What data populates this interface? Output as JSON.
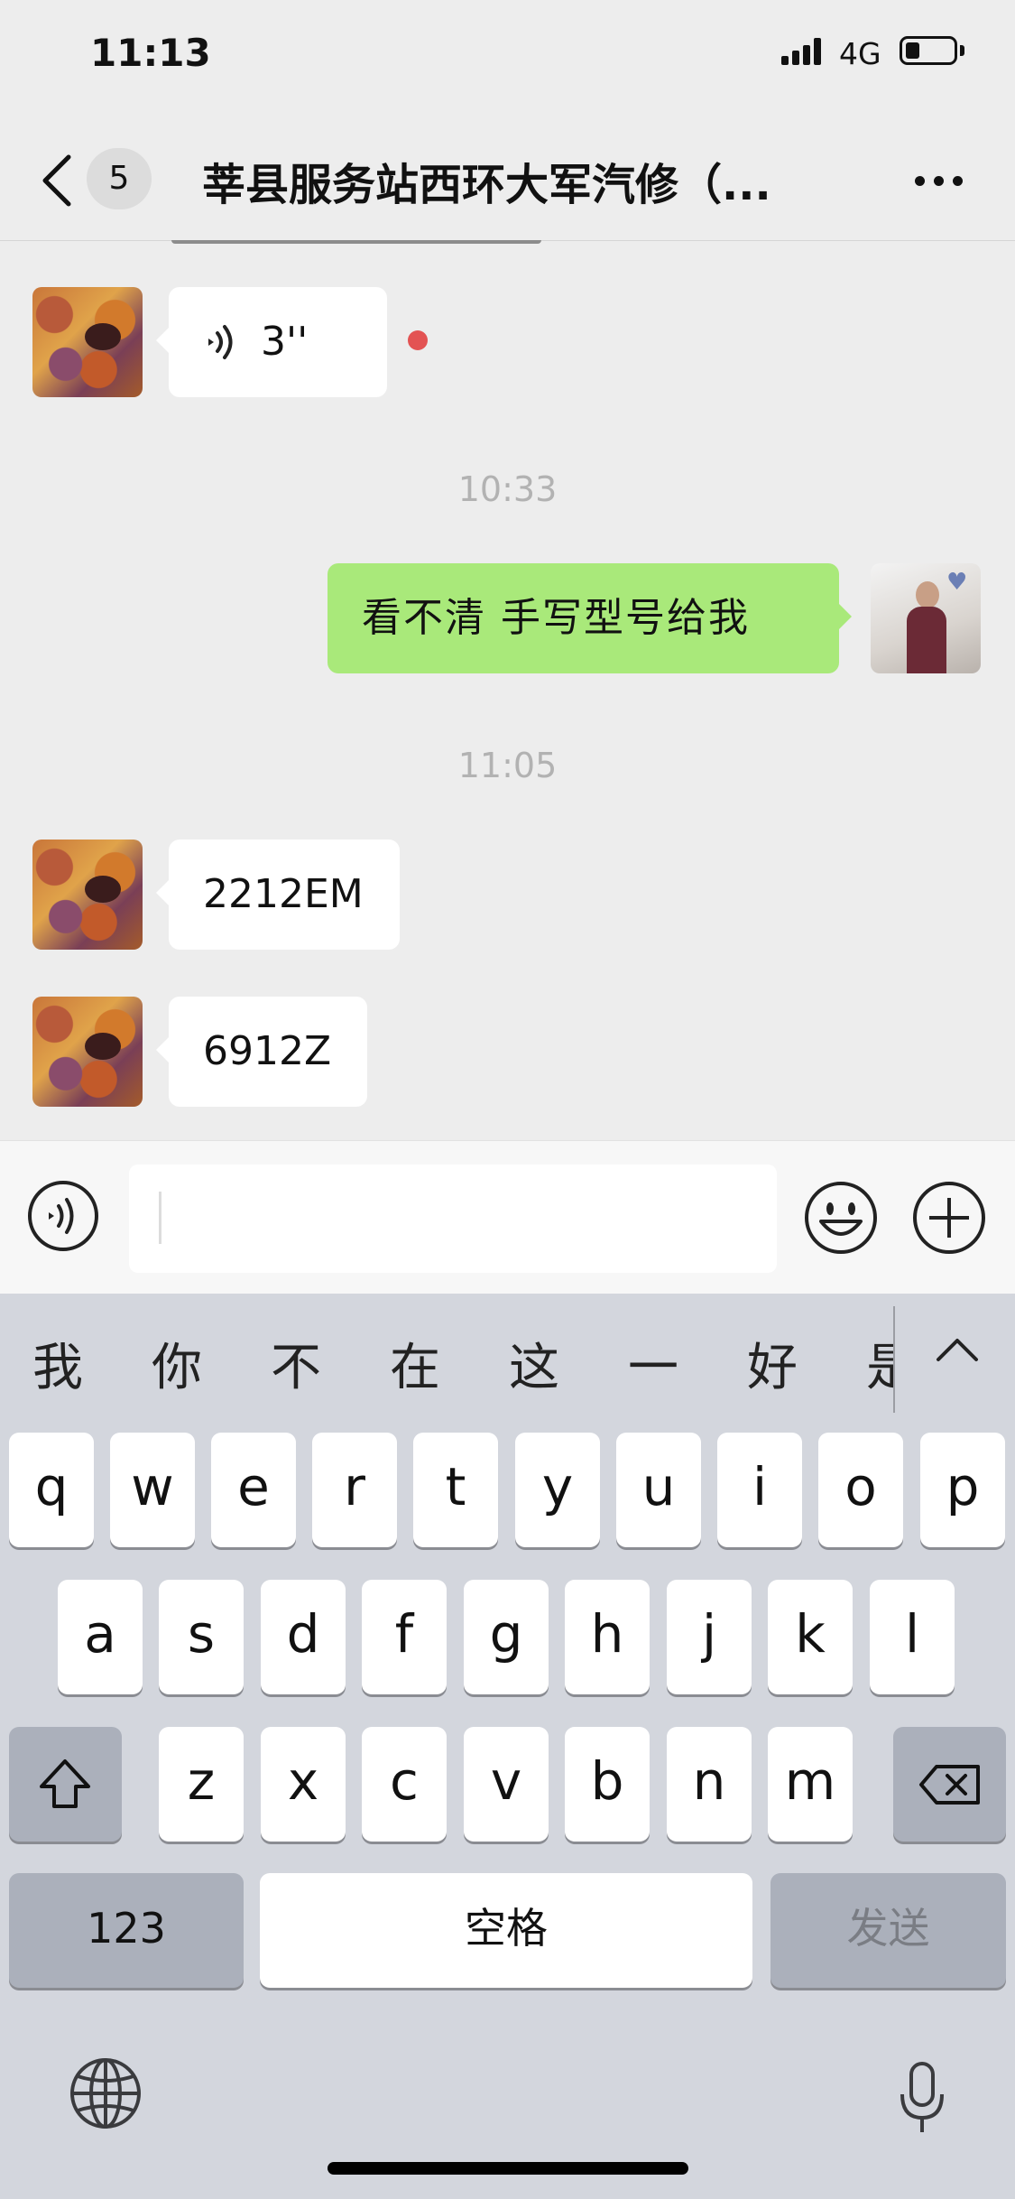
{
  "status_bar": {
    "time": "11:13",
    "network": "4G",
    "battery_level": 0.3
  },
  "nav": {
    "unread_count": "5",
    "title": "莘县服务站西环大军汽修（..."
  },
  "messages": {
    "voice_duration": "3''",
    "time_1": "10:33",
    "sent_text": "看不清  手写型号给我",
    "time_2": "11:05",
    "recv_1": "2212EM",
    "recv_2": "6912Z"
  },
  "input": {
    "value": "",
    "placeholder": ""
  },
  "keyboard": {
    "candidates": [
      "我",
      "你",
      "不",
      "在",
      "这",
      "一",
      "好",
      "是"
    ],
    "row1": [
      "q",
      "w",
      "e",
      "r",
      "t",
      "y",
      "u",
      "i",
      "o",
      "p"
    ],
    "row2": [
      "a",
      "s",
      "d",
      "f",
      "g",
      "h",
      "j",
      "k",
      "l"
    ],
    "row3": [
      "z",
      "x",
      "c",
      "v",
      "b",
      "n",
      "m"
    ],
    "numbers_label": "123",
    "space_label": "空格",
    "send_label": "发送"
  },
  "colors": {
    "sent_bubble": "#a9e97a",
    "unread_dot": "#e35353",
    "keyboard_bg": "#d3d6dd"
  },
  "icons": [
    "back-icon",
    "more-icon",
    "voice-icon",
    "voice-mode-icon",
    "emoji-icon",
    "plus-icon",
    "shift-icon",
    "backspace-icon",
    "globe-icon",
    "mic-icon"
  ]
}
